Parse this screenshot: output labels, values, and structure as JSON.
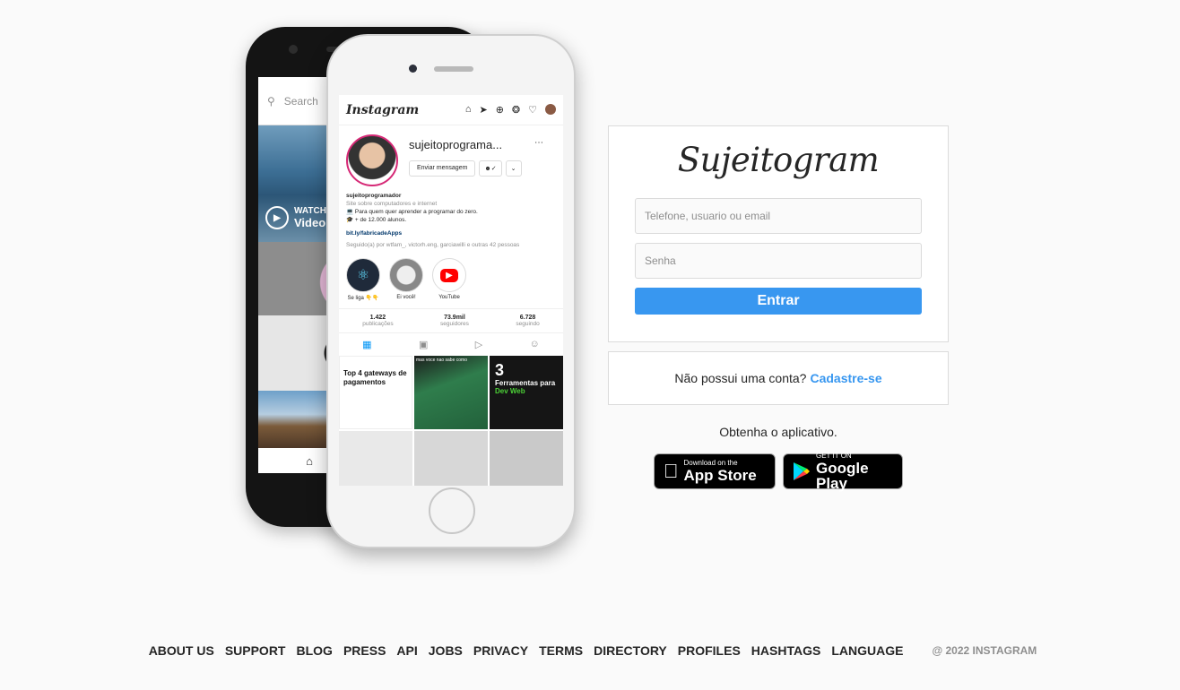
{
  "app": {
    "logo": "Sujeitogram"
  },
  "login": {
    "user_placeholder": "Telefone, usuario ou email",
    "password_placeholder": "Senha",
    "submit_label": "Entrar"
  },
  "signup": {
    "question": "Não possui uma conta?",
    "link": "Cadastre-se"
  },
  "get_app": {
    "text": "Obtenha o aplicativo.",
    "apple": {
      "small": "Download on the",
      "large": "App Store"
    },
    "google": {
      "small": "GET IT ON",
      "large": "Google Play"
    }
  },
  "phone": {
    "search_placeholder": "Search",
    "watch_label": "WATCH",
    "video_label": "Video",
    "ig_logo": "Instagram",
    "handle": "sujeitoprograma...",
    "send_message": "Enviar mensagem",
    "bio_name": "sujeitoprogramador",
    "bio_line1": "Site sobre computadores e internet",
    "bio_line2": "💻 Para quem quer aprender a programar do zero.",
    "bio_line3": "🎓 + de 12.000 alunos.",
    "bio_link": "bit.ly/fabricadeApps",
    "followed_by": "Seguido(a) por wtfam_, victorh.eng, garciawilli e outras 42 pessoas",
    "highlights": [
      "Se liga 👇👇",
      "Ei você!",
      "YouTube"
    ],
    "stats": [
      {
        "value": "1.422",
        "label": "publicações"
      },
      {
        "value": "73.9mil",
        "label": "seguidores"
      },
      {
        "value": "6.728",
        "label": "seguindo"
      }
    ],
    "post1": "Top 4 gateways de pagamentos",
    "post2": "mas voce nao sabe como",
    "post3_num": "3",
    "post3_text": "Ferramentas para",
    "post3_tag": "Dev Web"
  },
  "footer": {
    "links": [
      "ABOUT US",
      "SUPPORT",
      "BLOG",
      "PRESS",
      "API",
      "JOBS",
      "PRIVACY",
      "TERMS",
      "DIRECTORY",
      "PROFILES",
      "HASHTAGS",
      "LANGUAGE"
    ],
    "copyright": "@ 2022 INSTAGRAM"
  },
  "colors": {
    "primary": "#3897f0",
    "background": "#fafafa",
    "border": "#dbdbdb"
  }
}
